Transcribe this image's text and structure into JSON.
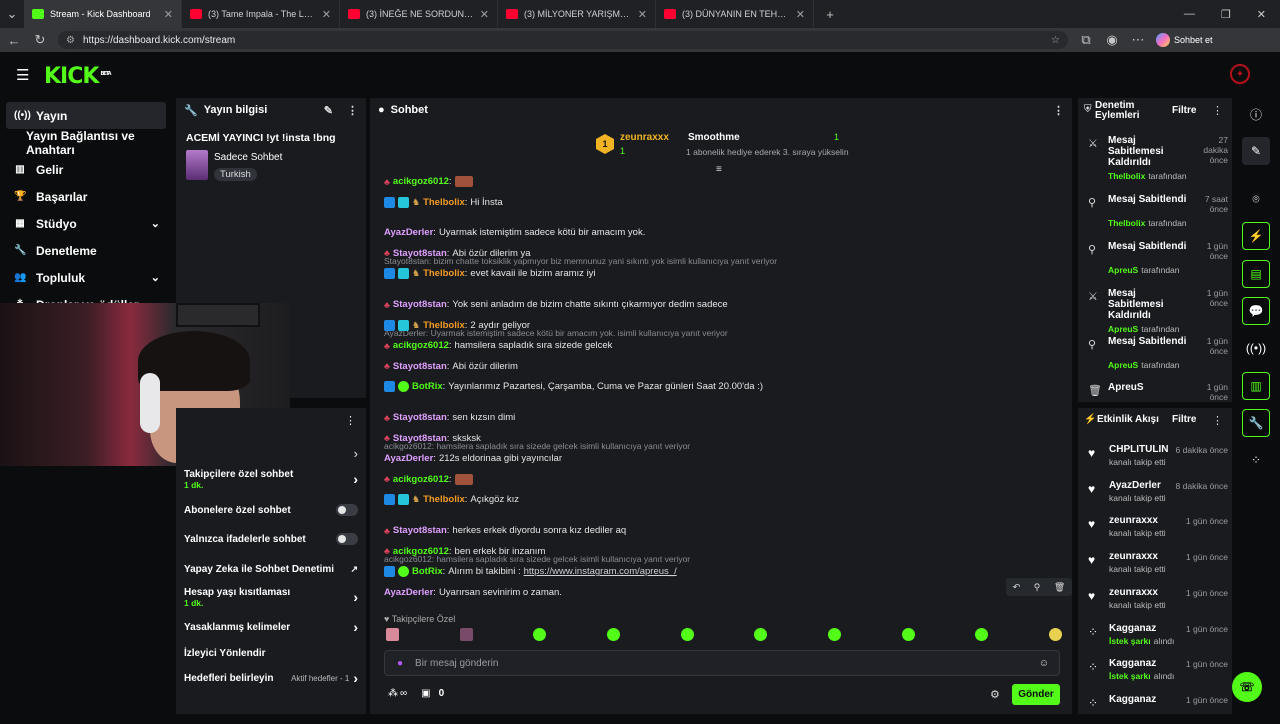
{
  "browser": {
    "tabs": [
      {
        "title": "Stream - Kick Dashboard",
        "active": true
      },
      {
        "title": "(3) Tame Impala - The Less I K",
        "active": false
      },
      {
        "title": "(3) İNEĞE NE SORDUN? | 5Sriders",
        "active": false
      },
      {
        "title": "(3) MİLYONER YARIŞMASINI DOLA",
        "active": false
      },
      {
        "title": "(3) DÜNYANIN EN TEHLİKELİ TREN",
        "active": false
      }
    ],
    "new_tab": "+",
    "url": "https://dashboard.kick.com/stream",
    "copilot_label": "Sohbet et"
  },
  "brand": {
    "logo": "KICK",
    "beta": "BETA",
    "accent": "#53fc18"
  },
  "sidebar": {
    "items": [
      {
        "label": "Yayın",
        "icon": "broadcast-icon",
        "active": true
      },
      {
        "label": "Yayın Bağlantısı ve Anahtarı",
        "icon": "",
        "active": false
      },
      {
        "label": "Gelir",
        "icon": "chart-icon",
        "active": false
      },
      {
        "label": "Başarılar",
        "icon": "trophy-icon",
        "active": false
      },
      {
        "label": "Stüdyo",
        "icon": "studio-icon",
        "active": false
      },
      {
        "label": "Denetleme",
        "icon": "wrench-icon",
        "active": false
      },
      {
        "label": "Topluluk",
        "icon": "people-icon",
        "active": false
      },
      {
        "label": "Droplar ve ödüller",
        "icon": "gift-icon",
        "active": false
      }
    ]
  },
  "stream_info": {
    "title": "Yayın bilgisi",
    "stream_title": "ACEMİ YAYINCI !yt !insta !bng",
    "category": "Sadece Sohbet",
    "language": "Turkish"
  },
  "chat_settings": {
    "rows": [
      {
        "label": "Takipçilere özel sohbet",
        "sub": "1 dk.",
        "control": "chevron"
      },
      {
        "label": "Abonelere özel sohbet",
        "sub": "",
        "control": "toggle"
      },
      {
        "label": "Yalnızca ifadelerle sohbet",
        "sub": "",
        "control": "toggle"
      },
      {
        "label": "Yapay Zeka ile Sohbet Denetimi",
        "sub": "",
        "control": "external"
      },
      {
        "label": "Hesap yaşı kısıtlaması",
        "sub": "1 dk.",
        "control": "chevron"
      },
      {
        "label": "Yasaklanmış kelimeler",
        "sub": "",
        "control": "chevron"
      },
      {
        "label": "İzleyici Yönlendir",
        "sub": "",
        "control": "none"
      },
      {
        "label": "Hedefleri belirleyin",
        "sub": "",
        "control": "chevron",
        "extra": "Aktif hedefler - 1"
      }
    ]
  },
  "chat": {
    "title": "Sohbet",
    "pinned_top": {
      "user": "zeunraxxx",
      "count": "1",
      "rank": "1",
      "user2": "Smoothme",
      "count2": "1",
      "note": "1 abonelik hediye ederek 3. sıraya yükselin"
    },
    "messages": [
      {
        "user": "acikgoz6012",
        "text": "",
        "emote": true
      },
      {
        "user": "Thelbolix",
        "text": "Hi İnsta"
      },
      {
        "reply": "Stayot8stan: bizim chatte toksiklik yapmıyor biz memnunuz yani sıkıntı yok isimli kullanıcıya yanıt veriyor"
      },
      {
        "user": "AyazDerler",
        "text": "Uyarmak istemiştim sadece kötü bir amacım yok."
      },
      {
        "user": "Stayot8stan",
        "text": "Abi özür dilerim ya"
      },
      {
        "user": "Thelbolix",
        "text": "evet kavaii ile bizim aramız iyi"
      },
      {
        "reply": "AyazDerler: Uyarmak istemiştim sadece kötü bir amacım yok. isimli kullanıcıya yanıt veriyor"
      },
      {
        "user": "Stayot8stan",
        "text": "Yok seni anladım de bizim chatte sıkıntı çıkarmıyor dedim sadece"
      },
      {
        "user": "Thelbolix",
        "text": "2 aydır geliyor"
      },
      {
        "user": "acikgoz6012",
        "text": "hamsilera sapladık sıra sizede gelcek"
      },
      {
        "user": "Stayot8stan",
        "text": "Abi özür dilerim"
      },
      {
        "user": "BotRix",
        "text": "Yayınlarımız Pazartesi, Çarşamba, Cuma ve Pazar günleri Saat 20.00'da :)"
      },
      {
        "reply": "acikgoz6012: hamsilera sapladık sıra sizede gelcek isimli kullanıcıya yanıt veriyor"
      },
      {
        "user": "Stayot8stan",
        "text": "sen kızsın dimi"
      },
      {
        "user": "Stayot8stan",
        "text": "sksksk"
      },
      {
        "user": "AyazDerler",
        "text": "212s eldorinaa gibi yayıncılar"
      },
      {
        "user": "acikgoz6012",
        "text": "",
        "emote": true
      },
      {
        "user": "Thelbolix",
        "text": "Açıkgöz kız"
      },
      {
        "reply": "acikgoz6012: hamsilera sapladık sıra sizede gelcek isimli kullanıcıya yanıt veriyor"
      },
      {
        "user": "Stayot8stan",
        "text": "herkes erkek diyordu sonra kız dediler aq"
      },
      {
        "user": "acikgoz6012",
        "text": "ben erkek bir inzanım"
      },
      {
        "user": "BotRix",
        "text": "Alırım bi takibini : ",
        "link": "https://www.instagram.com/apreus_/"
      },
      {
        "user": "AyazDerler",
        "text": "Uyarırsan sevinirim o zaman."
      }
    ],
    "followers_only": "Takipçilere Özel",
    "input_placeholder": "Bir mesaj gönderin",
    "points": "∞",
    "gift_count": "0",
    "send_label": "Gönder"
  },
  "mod_actions": {
    "title": "Denetim Eylemleri",
    "filter": "Filtre",
    "rows": [
      {
        "title": "Mesaj Sabitlemesi Kaldırıldı",
        "time": "27 dakika önce",
        "by": "Thelbolix",
        "suffix": "tarafından",
        "icon": "unpin-icon"
      },
      {
        "title": "Mesaj Sabitlendi",
        "time": "7 saat önce",
        "by": "Thelbolix",
        "suffix": "tarafından",
        "icon": "pin-icon"
      },
      {
        "title": "Mesaj Sabitlendi",
        "time": "1 gün önce",
        "by": "ApreuS",
        "suffix": "tarafından",
        "icon": "pin-icon"
      },
      {
        "title": "Mesaj Sabitlemesi Kaldırıldı",
        "time": "1 gün önce",
        "by": "ApreuS",
        "suffix": "tarafından",
        "icon": "unpin-icon"
      },
      {
        "title": "Mesaj Sabitlendi",
        "time": "1 gün önce",
        "by": "ApreuS",
        "suffix": "tarafından",
        "icon": "pin-icon"
      },
      {
        "title": "ApreuS",
        "time": "1 gün önce",
        "by": "",
        "suffix": "",
        "icon": "trash-icon"
      }
    ]
  },
  "activity": {
    "title": "Etkinlik Akışı",
    "filter": "Filtre",
    "rows": [
      {
        "name": "CHPLITULIN",
        "time": "6 dakika önce",
        "sub": "kanalı takip etti",
        "icon": "heart-icon"
      },
      {
        "name": "AyazDerler",
        "time": "8 dakika önce",
        "sub": "kanalı takip etti",
        "icon": "heart-icon"
      },
      {
        "name": "zeunraxxx",
        "time": "1 gün önce",
        "sub": "kanalı takip etti",
        "icon": "heart-icon"
      },
      {
        "name": "zeunraxxx",
        "time": "1 gün önce",
        "sub": "kanalı takip etti",
        "icon": "heart-icon"
      },
      {
        "name": "zeunraxxx",
        "time": "1 gün önce",
        "sub": "kanalı takip etti",
        "icon": "heart-icon"
      },
      {
        "name": "Kagganaz",
        "time": "1 gün önce",
        "sub_hl": "İstek şarkı",
        "sub": "alındı",
        "icon": "coin-icon"
      },
      {
        "name": "Kagganaz",
        "time": "1 gün önce",
        "sub_hl": "İstek şarkı",
        "sub": "alındı",
        "icon": "coin-icon"
      },
      {
        "name": "Kagganaz",
        "time": "1 gün önce",
        "sub": "",
        "icon": "coin-icon"
      }
    ]
  }
}
